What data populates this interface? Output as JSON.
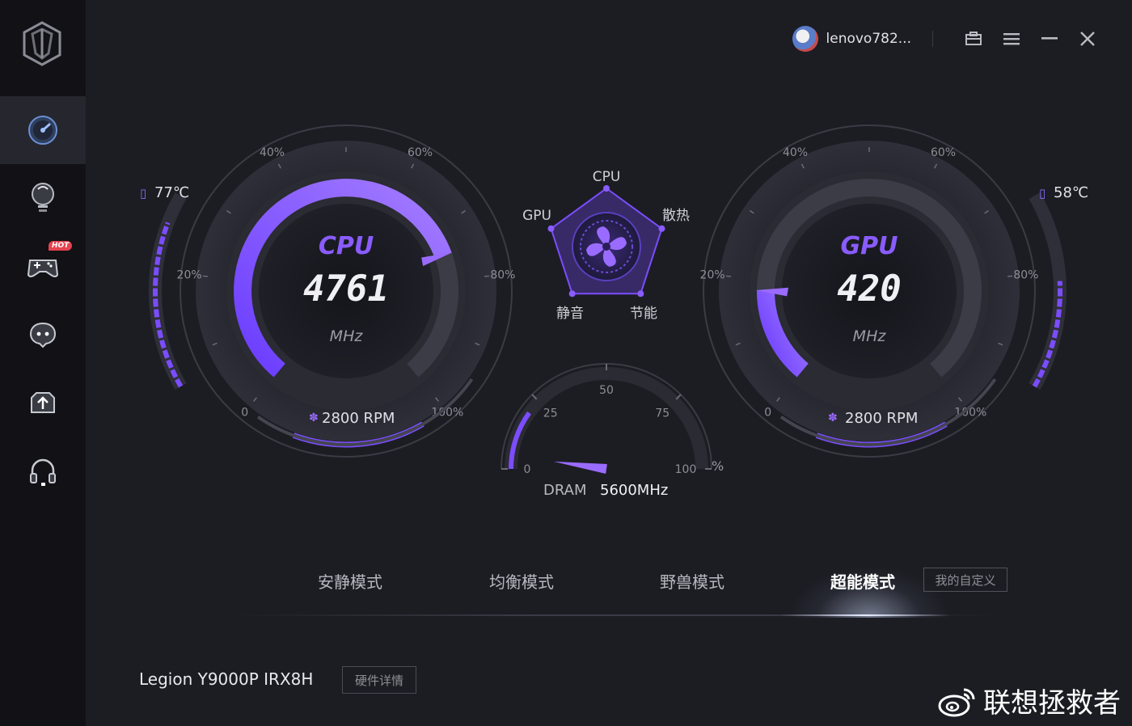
{
  "user": {
    "name": "lenovo782..."
  },
  "sidebar": {
    "items": [
      {
        "icon": "speedometer-icon",
        "active": true
      },
      {
        "icon": "lightbulb-icon",
        "active": false
      },
      {
        "icon": "gamepad-icon",
        "active": false,
        "badge": "HOT"
      },
      {
        "icon": "chat-icon",
        "active": false
      },
      {
        "icon": "upload-icon",
        "active": false
      },
      {
        "icon": "headset-icon",
        "active": false
      }
    ]
  },
  "cpu": {
    "label": "CPU",
    "value": "4761",
    "unit": "MHz",
    "temp": "77℃",
    "fan": "2800 RPM",
    "load_fraction": 0.75,
    "temp_fraction": 0.85,
    "ticks": [
      "0",
      "20%",
      "40%",
      "60%",
      "80%",
      "100%"
    ]
  },
  "gpu": {
    "label": "GPU",
    "value": "420",
    "unit": "MHz",
    "temp": "58℃",
    "fan": "2800 RPM",
    "load_fraction": 0.18,
    "temp_fraction": 0.55,
    "ticks": [
      "0",
      "20%",
      "40%",
      "60%",
      "80%",
      "100%"
    ]
  },
  "radar": {
    "labels": [
      "CPU",
      "散热",
      "节能",
      "静音",
      "GPU"
    ]
  },
  "dram": {
    "label": "DRAM",
    "value": "5600MHz",
    "unit": "%",
    "percent": 20,
    "ticks": [
      "0",
      "25",
      "50",
      "75",
      "100"
    ]
  },
  "modes": {
    "tabs": [
      "安静模式",
      "均衡模式",
      "野兽模式",
      "超能模式"
    ],
    "active": 3,
    "custom": "我的自定义"
  },
  "device": {
    "name": "Legion Y9000P IRX8H",
    "details_button": "硬件详情"
  },
  "watermark": "联想拯救者",
  "colors": {
    "accent": "#7b4dff",
    "accent_light": "#9a6bff",
    "background": "#1c1d23",
    "sidebar": "#111116"
  }
}
